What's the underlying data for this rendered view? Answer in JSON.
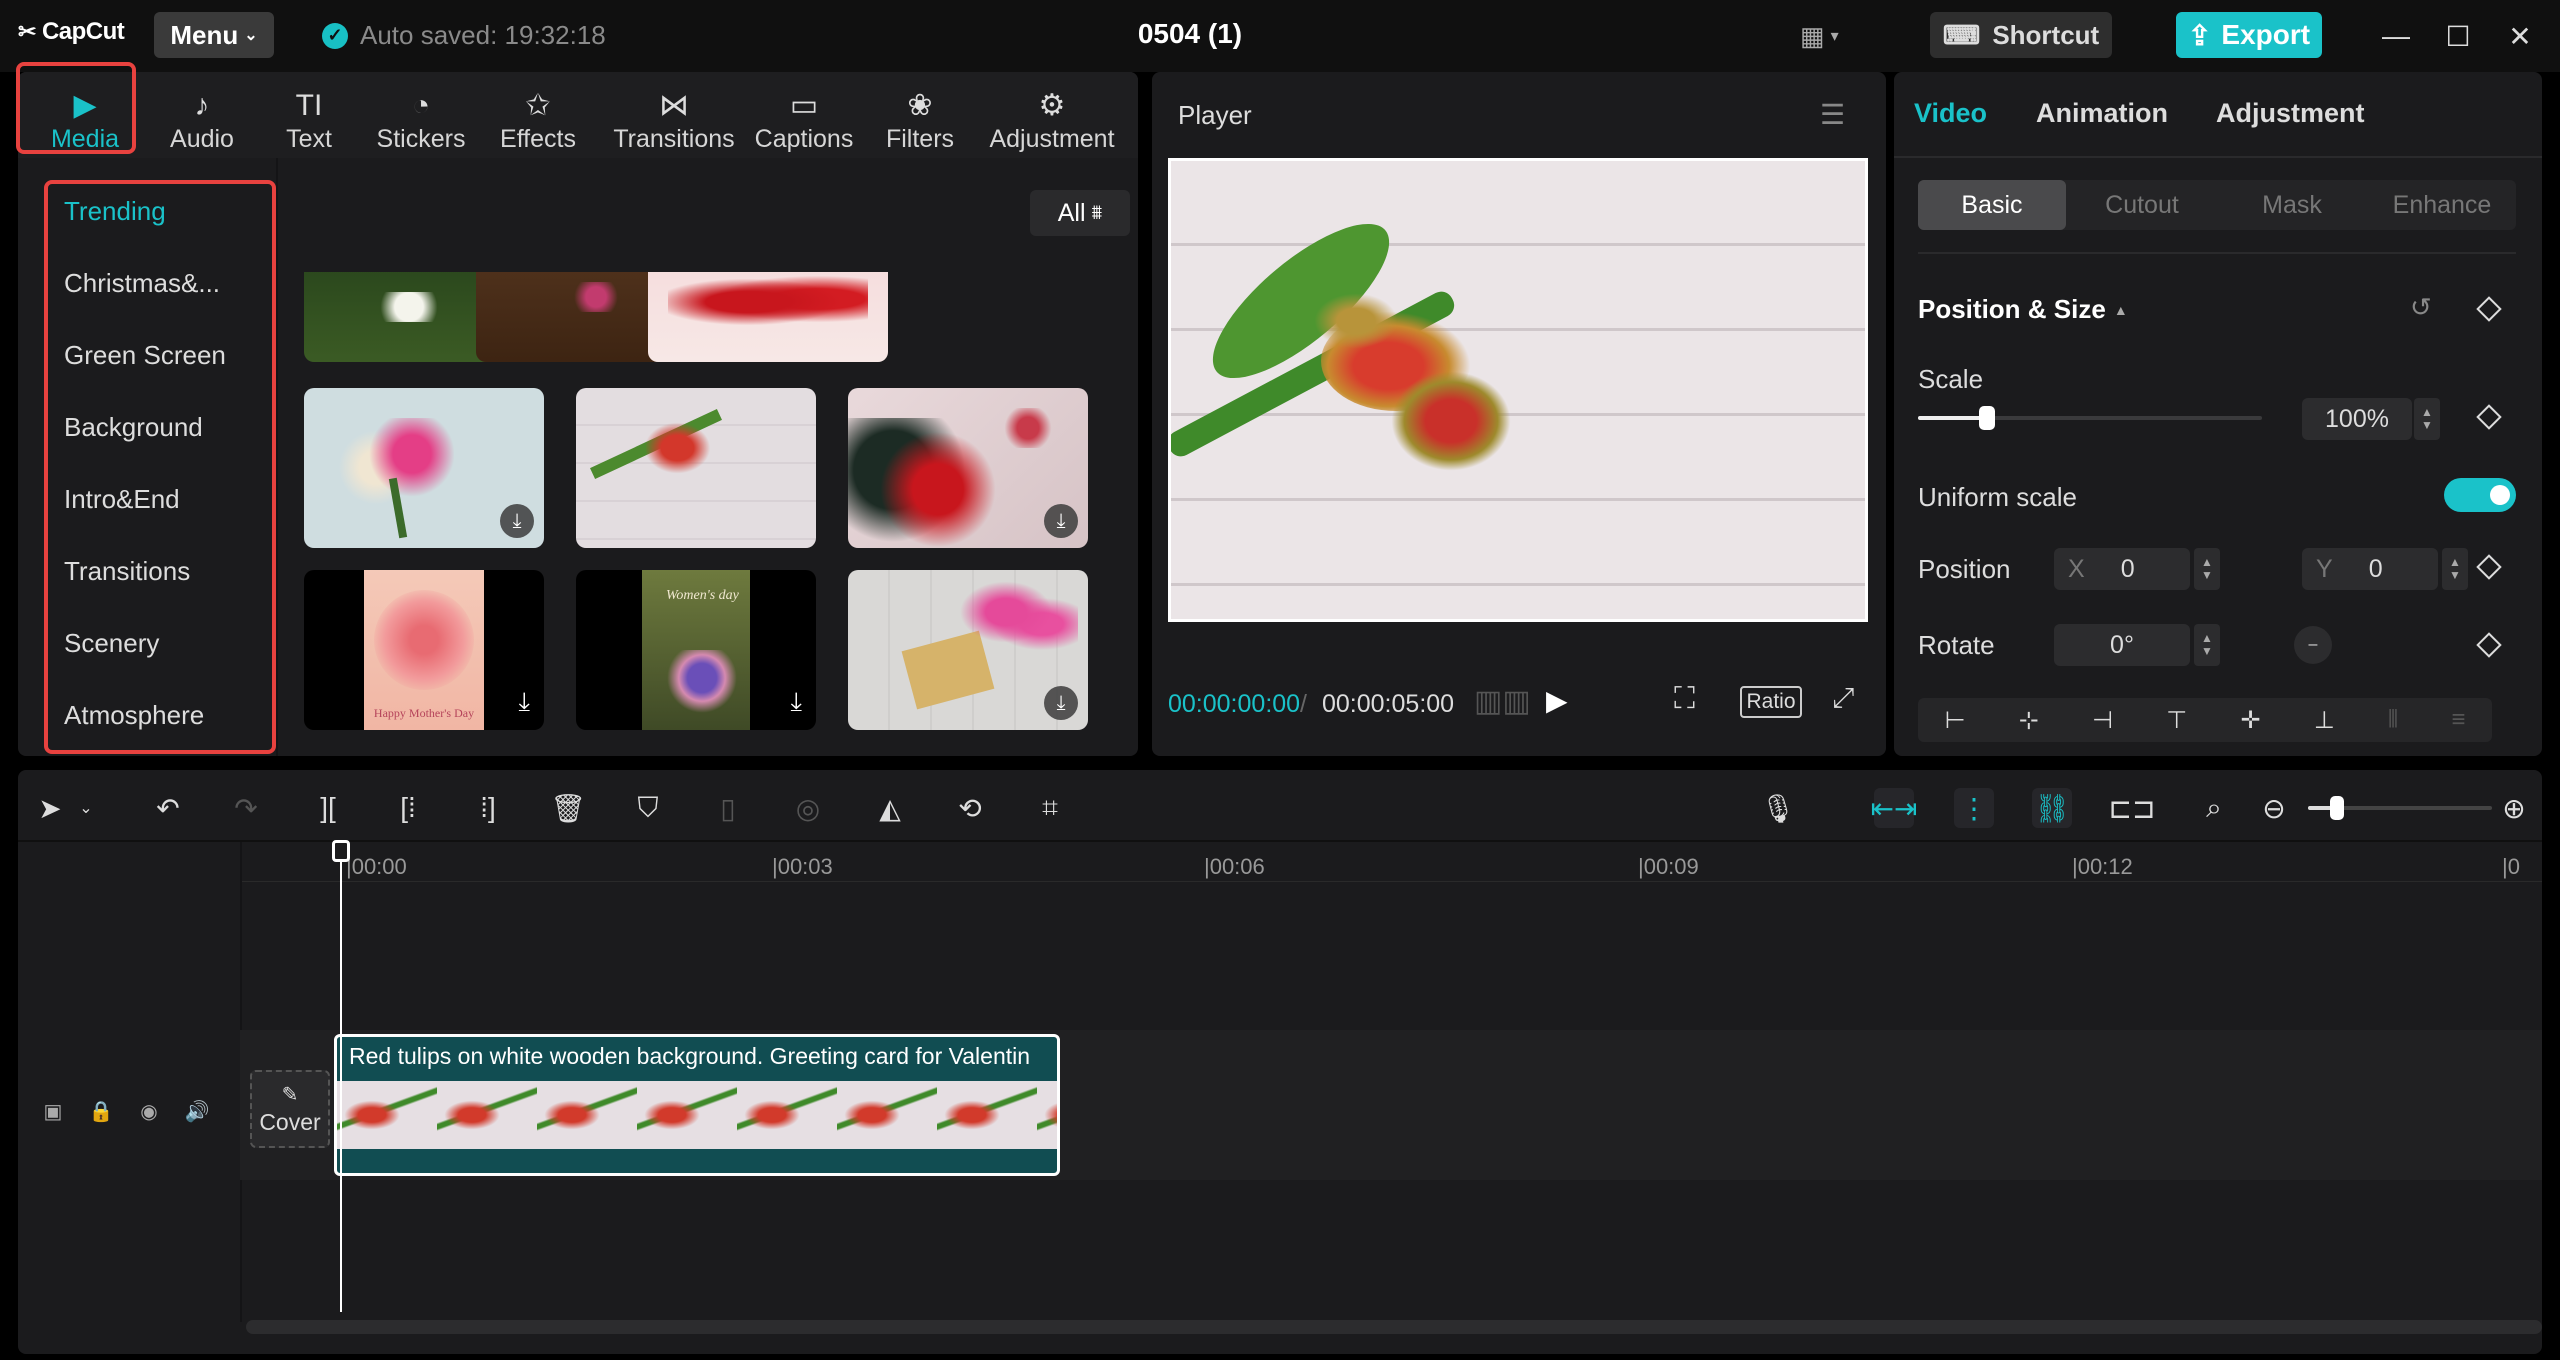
{
  "titlebar": {
    "app_name": "CapCut",
    "menu_label": "Menu",
    "autosave": "Auto saved: 19:32:18",
    "project_title": "0504 (1)",
    "shortcut_label": "Shortcut",
    "export_label": "Export"
  },
  "media_tabs": [
    {
      "label": "Media",
      "icon": "media-icon"
    },
    {
      "label": "Audio",
      "icon": "audio-icon"
    },
    {
      "label": "Text",
      "icon": "text-icon"
    },
    {
      "label": "Stickers",
      "icon": "stickers-icon"
    },
    {
      "label": "Effects",
      "icon": "effects-icon"
    },
    {
      "label": "Transitions",
      "icon": "transitions-icon"
    },
    {
      "label": "Captions",
      "icon": "captions-icon"
    },
    {
      "label": "Filters",
      "icon": "filters-icon"
    },
    {
      "label": "Adjustment",
      "icon": "adjustment-icon"
    }
  ],
  "categories": [
    "Trending",
    "Christmas&...",
    "Green Screen",
    "Background",
    "Intro&End",
    "Transitions",
    "Scenery",
    "Atmosphere"
  ],
  "filter_label": "All",
  "thumb_text": {
    "mothers_day": "Happy Mother's Day",
    "womens_day": "Women's day"
  },
  "player": {
    "title": "Player",
    "current_time": "00:00:00:00",
    "duration": "00:00:05:00",
    "ratio_label": "Ratio"
  },
  "props": {
    "tabs": [
      "Video",
      "Animation",
      "Adjustment"
    ],
    "subtabs": [
      "Basic",
      "Cutout",
      "Mask",
      "Enhance"
    ],
    "section": "Position & Size",
    "scale_label": "Scale",
    "scale_value": "100%",
    "scale_level": 0.2,
    "uniform_label": "Uniform scale",
    "uniform_on": true,
    "position_label": "Position",
    "x_label": "X",
    "x_value": "0",
    "y_label": "Y",
    "y_value": "0",
    "rotate_label": "Rotate",
    "rotate_value": "0°"
  },
  "timeline": {
    "ruler": [
      "|00:00",
      "|00:03",
      "|00:06",
      "|00:09",
      "|00:12",
      "|0"
    ],
    "clip_title": "Red tulips on white wooden background. Greeting card for Valentin",
    "cover_label": "Cover"
  },
  "colors": {
    "accent": "#1ac2c9",
    "highlight": "#e8423f",
    "panel": "#1b1b1d"
  }
}
